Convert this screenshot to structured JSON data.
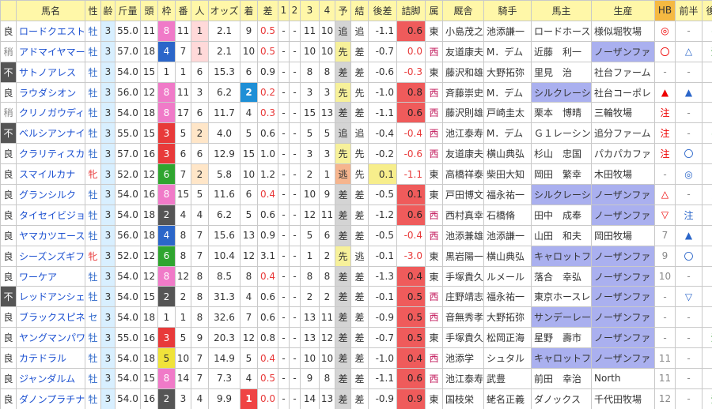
{
  "headers": [
    "",
    "馬名",
    "性",
    "齢",
    "斤量",
    "頭",
    "枠",
    "番",
    "人",
    "オッズ",
    "着",
    "差",
    "1",
    "2",
    "3",
    "4",
    "予",
    "結",
    "後差",
    "詰脚",
    "属",
    "厩舎",
    "騎手",
    "馬主",
    "生産",
    "HB",
    "前半",
    "後半"
  ],
  "rows": [
    {
      "cond": "良",
      "name": "ロードクエスト",
      "sex": "牡",
      "age": "3",
      "kin": "55.0",
      "to": "11",
      "waku": "8",
      "ban": "11",
      "nin": "1",
      "odds": "2.1",
      "cha": "9",
      "sa": "0.5",
      "c1": "-",
      "c2": "-",
      "c3": "11",
      "c4": "10",
      "yo": "追",
      "ke": "追",
      "ato": "-1.1",
      "tsu": "0.6",
      "zoku": "東",
      "stable": "小島茂之",
      "jockey": "池添謙一",
      "owner": "ロードホース",
      "breeder": "様似堀牧場",
      "hb": "◎",
      "z": "-",
      "k": "◎"
    },
    {
      "cond": "稍",
      "name": "アドマイヤマーズ",
      "sex": "牡",
      "age": "3",
      "kin": "57.0",
      "to": "18",
      "waku": "4",
      "ban": "7",
      "nin": "1",
      "odds": "2.1",
      "cha": "10",
      "sa": "0.5",
      "c1": "-",
      "c2": "-",
      "c3": "10",
      "c4": "10",
      "yo": "先",
      "ke": "差",
      "ato": "-0.7",
      "tsu": "0.0",
      "zoku": "西",
      "stable": "友道康夫",
      "jockey": "M．デム",
      "owner": "近藤　利一",
      "breeder": "ノーザンファ",
      "hb": "〇",
      "z": "△",
      "k": "注"
    },
    {
      "cond": "不",
      "name": "サトノアレス",
      "sex": "牡",
      "age": "3",
      "kin": "54.0",
      "to": "15",
      "waku": "1",
      "ban": "1",
      "nin": "6",
      "odds": "15.3",
      "cha": "6",
      "sa": "0.9",
      "c1": "-",
      "c2": "-",
      "c3": "8",
      "c4": "8",
      "yo": "差",
      "ke": "差",
      "ato": "-0.6",
      "tsu": "-0.3",
      "zoku": "東",
      "stable": "藤沢和雄",
      "jockey": "大野拓弥",
      "owner": "里見　治",
      "breeder": "社台ファーム",
      "hb": "-",
      "z": "-",
      "k": "-"
    },
    {
      "cond": "良",
      "name": "ラウダシオン",
      "sex": "牡",
      "age": "3",
      "kin": "56.0",
      "to": "12",
      "waku": "8",
      "ban": "11",
      "nin": "3",
      "odds": "6.2",
      "cha": "2",
      "sa": "0.2",
      "c1": "-",
      "c2": "-",
      "c3": "3",
      "c4": "3",
      "yo": "先",
      "ke": "先",
      "ato": "-1.0",
      "tsu": "0.8",
      "zoku": "西",
      "stable": "斉藤崇史",
      "jockey": "M．デム",
      "owner": "シルクレーシ",
      "breeder": "社台コーポレ",
      "hb": "▲",
      "z": "▲",
      "k": "▽"
    },
    {
      "cond": "稍",
      "name": "クリノガウディー",
      "sex": "牡",
      "age": "3",
      "kin": "54.0",
      "to": "18",
      "waku": "8",
      "ban": "17",
      "nin": "6",
      "odds": "11.7",
      "cha": "4",
      "sa": "0.3",
      "c1": "-",
      "c2": "-",
      "c3": "15",
      "c4": "13",
      "yo": "差",
      "ke": "差",
      "ato": "-1.1",
      "tsu": "0.6",
      "zoku": "西",
      "stable": "藤沢則雄",
      "jockey": "戸崎圭太",
      "owner": "栗本　博晴",
      "breeder": "三輪牧場",
      "hb": "注",
      "z": "-",
      "k": "-"
    },
    {
      "cond": "不",
      "name": "ベルシアンナイト",
      "sex": "牡",
      "age": "3",
      "kin": "55.0",
      "to": "15",
      "waku": "3",
      "ban": "5",
      "nin": "2",
      "odds": "4.0",
      "cha": "5",
      "sa": "0.6",
      "c1": "-",
      "c2": "-",
      "c3": "5",
      "c4": "5",
      "yo": "追",
      "ke": "追",
      "ato": "-0.4",
      "tsu": "-0.4",
      "zoku": "西",
      "stable": "池江泰寿",
      "jockey": "M．デム",
      "owner": "Ｇ１レーシン",
      "breeder": "追分ファーム",
      "hb": "注",
      "z": "-",
      "k": "◎"
    },
    {
      "cond": "良",
      "name": "クラリティスカイ",
      "sex": "牡",
      "age": "3",
      "kin": "57.0",
      "to": "16",
      "waku": "3",
      "ban": "6",
      "nin": "6",
      "odds": "12.9",
      "cha": "15",
      "sa": "1.0",
      "c1": "-",
      "c2": "-",
      "c3": "3",
      "c4": "3",
      "yo": "先",
      "ke": "先",
      "ato": "-0.2",
      "tsu": "-0.6",
      "zoku": "西",
      "stable": "友道康夫",
      "jockey": "横山典弘",
      "owner": "杉山　忠国",
      "breeder": "パカパカファ",
      "hb": "注",
      "z": "〇",
      "k": "-"
    },
    {
      "cond": "良",
      "name": "スマイルカナ",
      "sex": "牝",
      "age": "3",
      "kin": "52.0",
      "to": "12",
      "waku": "6",
      "ban": "7",
      "nin": "2",
      "odds": "5.8",
      "cha": "10",
      "sa": "1.2",
      "c1": "-",
      "c2": "-",
      "c3": "2",
      "c4": "1",
      "yo": "逃",
      "ke": "先",
      "ato": "0.1",
      "tsu": "-1.1",
      "zoku": "東",
      "stable": "高橋祥泰",
      "jockey": "柴田大知",
      "owner": "岡田　繁幸",
      "breeder": "木田牧場",
      "hb": "-",
      "z": "◎",
      "k": "-"
    },
    {
      "cond": "良",
      "name": "グランシルク",
      "sex": "牡",
      "age": "3",
      "kin": "54.0",
      "to": "16",
      "waku": "8",
      "ban": "15",
      "nin": "5",
      "odds": "11.6",
      "cha": "6",
      "sa": "0.4",
      "c1": "-",
      "c2": "-",
      "c3": "10",
      "c4": "9",
      "yo": "差",
      "ke": "差",
      "ato": "-0.5",
      "tsu": "0.1",
      "zoku": "東",
      "stable": "戸田博文",
      "jockey": "福永祐一",
      "owner": "シルクレーシ",
      "breeder": "ノーザンファ",
      "hb": "△",
      "z": "-",
      "k": "▲"
    },
    {
      "cond": "良",
      "name": "タイセイビジョン",
      "sex": "牡",
      "age": "3",
      "kin": "54.0",
      "to": "18",
      "waku": "2",
      "ban": "4",
      "nin": "4",
      "odds": "6.2",
      "cha": "5",
      "sa": "0.6",
      "c1": "-",
      "c2": "-",
      "c3": "12",
      "c4": "11",
      "yo": "差",
      "ke": "差",
      "ato": "-1.2",
      "tsu": "0.6",
      "zoku": "西",
      "stable": "西村真幸",
      "jockey": "石橋脩",
      "owner": "田中　成奉",
      "breeder": "ノーザンファ",
      "hb": "▽",
      "z": "注",
      "k": "-"
    },
    {
      "cond": "良",
      "name": "ヤマカツエース",
      "sex": "牡",
      "age": "3",
      "kin": "56.0",
      "to": "18",
      "waku": "4",
      "ban": "8",
      "nin": "7",
      "odds": "15.6",
      "cha": "13",
      "sa": "0.9",
      "c1": "-",
      "c2": "-",
      "c3": "5",
      "c4": "6",
      "yo": "差",
      "ke": "差",
      "ato": "-0.5",
      "tsu": "-0.4",
      "zoku": "西",
      "stable": "池添兼雄",
      "jockey": "池添謙一",
      "owner": "山田　和夫",
      "breeder": "岡田牧場",
      "hb": "7",
      "z": "▲",
      "k": "-"
    },
    {
      "cond": "良",
      "name": "シーズンズギフト",
      "sex": "牝",
      "age": "3",
      "kin": "52.0",
      "to": "12",
      "waku": "6",
      "ban": "8",
      "nin": "7",
      "odds": "10.4",
      "cha": "12",
      "sa": "3.1",
      "c1": "-",
      "c2": "-",
      "c3": "1",
      "c4": "2",
      "yo": "先",
      "ke": "逃",
      "ato": "-0.1",
      "tsu": "-3.0",
      "zoku": "東",
      "stable": "黒岩陽一",
      "jockey": "横山典弘",
      "owner": "キャロットフ",
      "breeder": "ノーザンファ",
      "hb": "9",
      "z": "〇",
      "k": "-"
    },
    {
      "cond": "良",
      "name": "ワーケア",
      "sex": "牡",
      "age": "3",
      "kin": "54.0",
      "to": "12",
      "waku": "8",
      "ban": "12",
      "nin": "8",
      "odds": "8.5",
      "cha": "8",
      "sa": "0.4",
      "c1": "-",
      "c2": "-",
      "c3": "8",
      "c4": "8",
      "yo": "差",
      "ke": "差",
      "ato": "-1.3",
      "tsu": "0.4",
      "zoku": "東",
      "stable": "手塚貴久",
      "jockey": "ルメール",
      "owner": "落合　幸弘",
      "breeder": "ノーザンファ",
      "hb": "10",
      "z": "-",
      "k": "-"
    },
    {
      "cond": "不",
      "name": "レッドアンシェル",
      "sex": "牡",
      "age": "3",
      "kin": "54.0",
      "to": "15",
      "waku": "2",
      "ban": "2",
      "nin": "8",
      "odds": "31.3",
      "cha": "4",
      "sa": "0.6",
      "c1": "-",
      "c2": "-",
      "c3": "2",
      "c4": "2",
      "yo": "差",
      "ke": "差",
      "ato": "-0.1",
      "tsu": "0.5",
      "zoku": "西",
      "stable": "庄野靖志",
      "jockey": "福永祐一",
      "owner": "東京ホースレ",
      "breeder": "ノーザンファ",
      "hb": "-",
      "z": "▽",
      "k": "-"
    },
    {
      "cond": "良",
      "name": "ブラックスピネル",
      "sex": "セ",
      "age": "3",
      "kin": "54.0",
      "to": "18",
      "waku": "1",
      "ban": "1",
      "nin": "8",
      "odds": "32.6",
      "cha": "7",
      "sa": "0.6",
      "c1": "-",
      "c2": "-",
      "c3": "13",
      "c4": "11",
      "yo": "差",
      "ke": "差",
      "ato": "-0.9",
      "tsu": "0.5",
      "zoku": "西",
      "stable": "音無秀孝",
      "jockey": "大野拓弥",
      "owner": "サンデーレー",
      "breeder": "ノーザンファ",
      "hb": "-",
      "z": "-",
      "k": "-"
    },
    {
      "cond": "良",
      "name": "ヤングマンパワー",
      "sex": "牡",
      "age": "3",
      "kin": "55.0",
      "to": "16",
      "waku": "3",
      "ban": "5",
      "nin": "9",
      "odds": "20.3",
      "cha": "12",
      "sa": "0.8",
      "c1": "-",
      "c2": "-",
      "c3": "13",
      "c4": "12",
      "yo": "差",
      "ke": "差",
      "ato": "-0.7",
      "tsu": "0.5",
      "zoku": "東",
      "stable": "手塚貴久",
      "jockey": "松岡正海",
      "owner": "星野　壽市",
      "breeder": "ノーザンファ",
      "hb": "-",
      "z": "-",
      "k": "注"
    },
    {
      "cond": "良",
      "name": "カテドラル",
      "sex": "牡",
      "age": "3",
      "kin": "54.0",
      "to": "18",
      "waku": "5",
      "ban": "10",
      "nin": "7",
      "odds": "14.9",
      "cha": "5",
      "sa": "0.4",
      "c1": "-",
      "c2": "-",
      "c3": "10",
      "c4": "10",
      "yo": "差",
      "ke": "差",
      "ato": "-1.0",
      "tsu": "0.4",
      "zoku": "西",
      "stable": "池添学",
      "jockey": "シュタル",
      "owner": "キャロットフ",
      "breeder": "ノーザンファ",
      "hb": "11",
      "z": "-",
      "k": "▲"
    },
    {
      "cond": "良",
      "name": "ジャンダルム",
      "sex": "牡",
      "age": "3",
      "kin": "54.0",
      "to": "15",
      "waku": "8",
      "ban": "14",
      "nin": "7",
      "odds": "7.3",
      "cha": "4",
      "sa": "0.5",
      "c1": "-",
      "c2": "-",
      "c3": "9",
      "c4": "8",
      "yo": "差",
      "ke": "差",
      "ato": "-1.1",
      "tsu": "0.6",
      "zoku": "西",
      "stable": "池江泰寿",
      "jockey": "武豊",
      "owner": "前田　幸治",
      "breeder": "North",
      "hb": "11",
      "z": "-",
      "k": "-"
    },
    {
      "cond": "良",
      "name": "ダノンプラチナ",
      "sex": "牡",
      "age": "3",
      "kin": "54.0",
      "to": "16",
      "waku": "2",
      "ban": "3",
      "nin": "4",
      "odds": "9.9",
      "cha": "1",
      "sa": "0.0",
      "c1": "-",
      "c2": "-",
      "c3": "14",
      "c4": "13",
      "yo": "差",
      "ke": "差",
      "ato": "-0.9",
      "tsu": "0.9",
      "zoku": "東",
      "stable": "国枝栄",
      "jockey": "蛯名正義",
      "owner": "ダノックス",
      "breeder": "千代田牧場",
      "hb": "12",
      "z": "-",
      "k": "注"
    }
  ],
  "colors": {
    "header": "#fff7a8",
    "owner_hi": "#aab0ef",
    "rank_blue": "#1e8fd6",
    "rank_red": "#ef4444"
  }
}
